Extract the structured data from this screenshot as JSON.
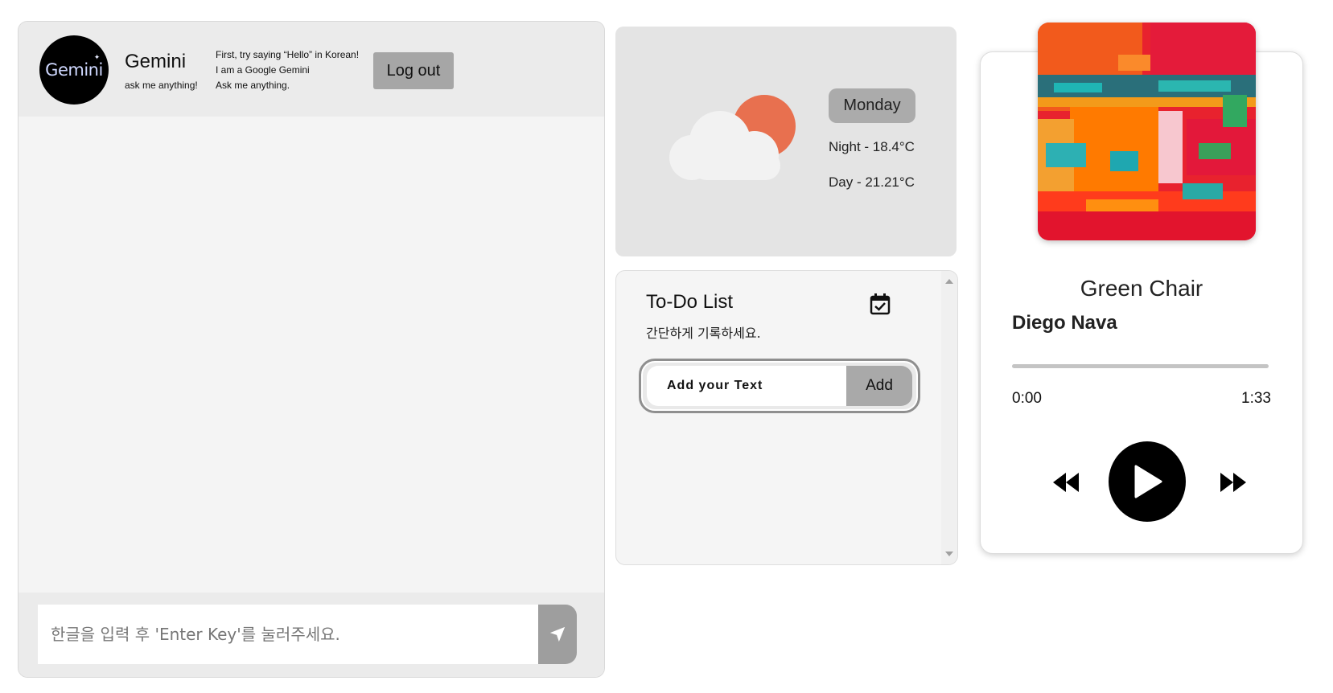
{
  "chat": {
    "bot_name": "Gemini",
    "logo_text": "Gemini",
    "bot_tagline": "ask me anything!",
    "description_lines": [
      "First, try saying “Hello” in Korean!",
      "I am a Google Gemini",
      "Ask me anything."
    ],
    "logout_label": "Log out",
    "input_placeholder": "한글을 입력 후 'Enter Key'를 눌러주세요.",
    "input_value": ""
  },
  "weather": {
    "day": "Monday",
    "night": "Night - 18.4°C",
    "daytime": "Day - 21.21°C",
    "icon": "partly-cloudy-icon",
    "sun_color": "#e8704f",
    "cloud_color": "#f2f2f2"
  },
  "todo": {
    "title": "To-Do List",
    "subtitle": "간단하게 기록하세요.",
    "input_placeholder": "Add your Text",
    "add_label": "Add",
    "items": []
  },
  "music": {
    "title": "Green Chair",
    "artist": "Diego Nava",
    "time_current": "0:00",
    "time_total": "1:33",
    "progress": 0
  },
  "colors": {
    "button_gray": "#a6a6a6",
    "panel_gray": "#e4e4e4",
    "chat_bg": "#f4f4f4"
  }
}
